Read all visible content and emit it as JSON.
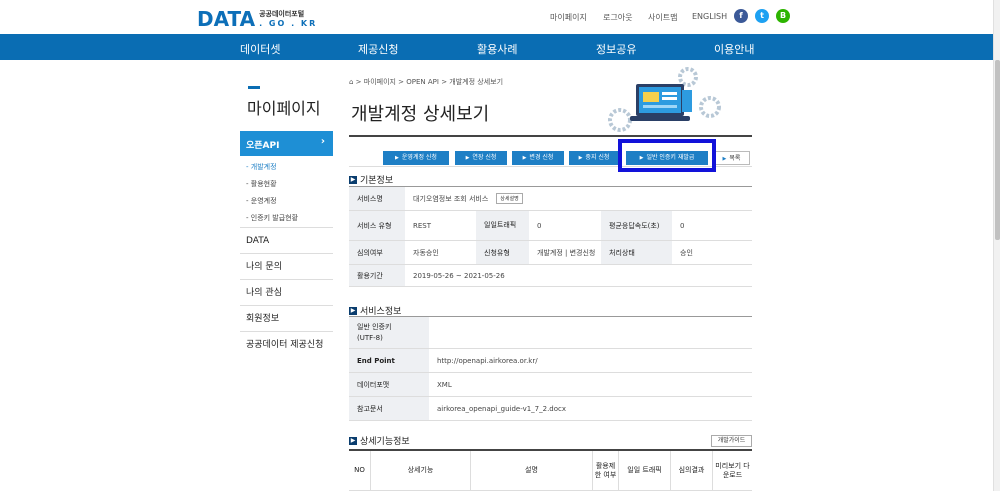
{
  "header": {
    "logo_main": "DATA",
    "logo_line1": "공공데이터포털",
    "logo_line2": ". GO . KR",
    "util_links": [
      "마이페이지",
      "로그아웃",
      "사이트맵",
      "ENGLISH"
    ],
    "sns": [
      {
        "name": "facebook",
        "glyph": "f",
        "color": "#3b5998"
      },
      {
        "name": "twitter",
        "glyph": "t",
        "color": "#1da1f2"
      },
      {
        "name": "blog",
        "glyph": "B",
        "color": "#2db400"
      }
    ]
  },
  "gnb": [
    "데이터셋",
    "제공신청",
    "활용사례",
    "정보공유",
    "이용안내"
  ],
  "lnb": {
    "title": "마이페이지",
    "active": "오픈API",
    "active_chevron": "›",
    "subitems": [
      "- 개발계정",
      "- 활용현황",
      "- 운영계정",
      "- 인증키 발급현황"
    ],
    "items": [
      "DATA",
      "나의 문의",
      "나의 관심",
      "회원정보",
      "공공데이터 제공신청"
    ]
  },
  "breadcrumb": "⌂ > 마이페이지 > OPEN API > 개발계정 상세보기",
  "page_title": "개발계정 상세보기",
  "actions": {
    "operate": "운영계정 신청",
    "extend": "연장 신청",
    "change": "변경 신청",
    "stop": "중지 신청",
    "reissue": "일반 인증키 재발급",
    "list": "목록"
  },
  "basic": {
    "title": "기본정보",
    "service_name_label": "서비스명",
    "service_name": "대기오염정보 조회 서비스",
    "detail_button": "상세설명",
    "service_type_label": "서비스 유형",
    "service_type": "REST",
    "daily_traffic_label": "일일트래픽",
    "daily_traffic": "0",
    "avg_response_label": "평균응답속도(초)",
    "avg_response": "0",
    "review_label": "심의여부",
    "review": "자동승인",
    "apply_type_label": "신청유형",
    "apply_type": "개발계정 | 변경신청",
    "status_label": "처리상태",
    "status": "승인",
    "period_label": "활용기간",
    "period": "2019-05-26 ~ 2021-05-26"
  },
  "service": {
    "title": "서비스정보",
    "key_label": "일반 인증키\n(UTF-8)",
    "key": "",
    "endpoint_label": "End Point",
    "endpoint": "http://openapi.airkorea.or.kr/",
    "format_label": "데이터포맷",
    "format": "XML",
    "doc_label": "참고문서",
    "doc": "airkorea_openapi_guide-v1_7_2.docx"
  },
  "detail": {
    "title": "상세기능정보",
    "guide_button": "개발가이드",
    "columns": [
      "NO",
      "상세기능",
      "설명",
      "활용제한 여부",
      "일일 트래픽",
      "심의결과",
      "미리보기 다운로드"
    ]
  }
}
